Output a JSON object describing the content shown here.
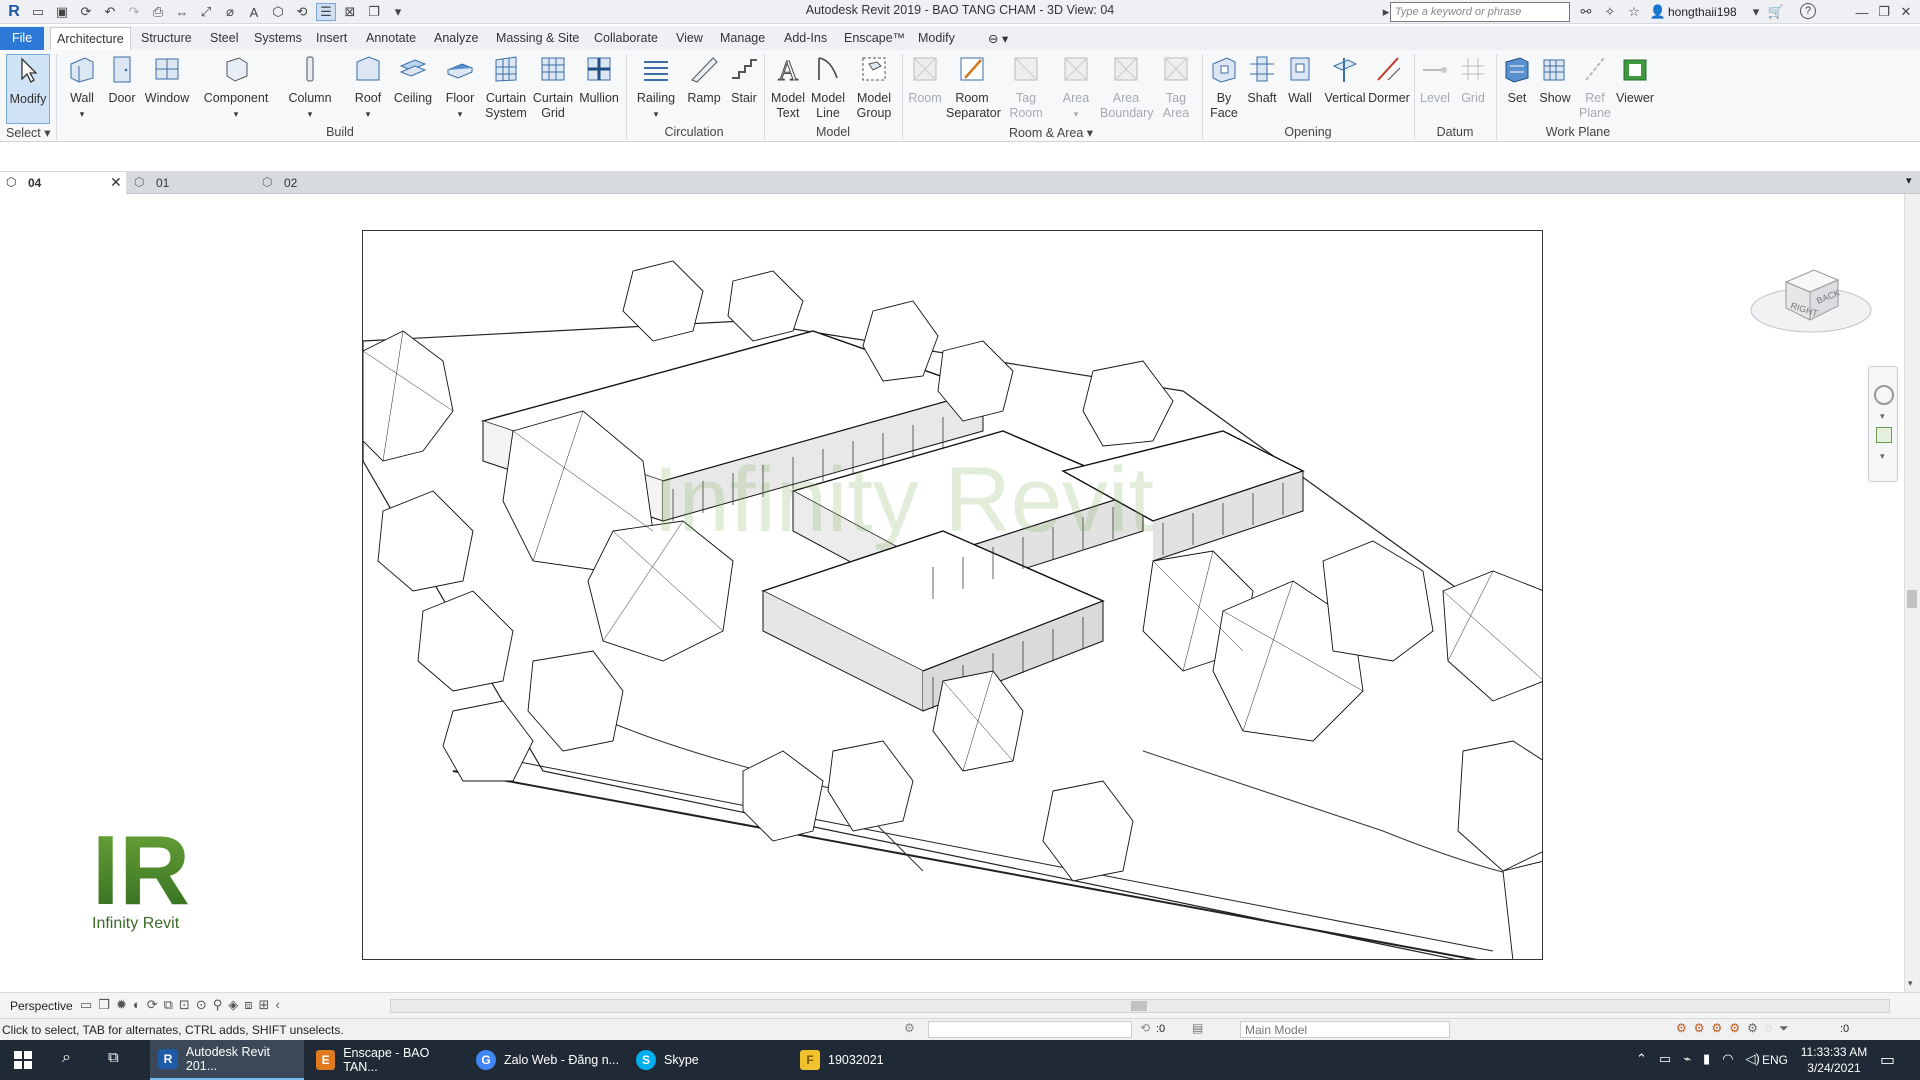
{
  "app": {
    "title": "Autodesk Revit 2019 - BAO TANG CHAM - 3D View: 04",
    "search_placeholder": "Type a keyword or phrase",
    "user": "hongthaii198",
    "help": "?"
  },
  "menu_tabs": [
    "File",
    "Architecture",
    "Structure",
    "Steel",
    "Systems",
    "Insert",
    "Annotate",
    "Analyze",
    "Massing & Site",
    "Collaborate",
    "View",
    "Manage",
    "Add-Ins",
    "Enscape™",
    "Modify"
  ],
  "ribbon": {
    "select": {
      "modify": "Modify",
      "label": "Select"
    },
    "build": {
      "label": "Build",
      "items": [
        "Wall",
        "Door",
        "Window",
        "Component",
        "Column",
        "Roof",
        "Ceiling",
        "Floor",
        "Curtain",
        "Curtain",
        "Mullion"
      ],
      "sub": [
        "",
        "",
        "",
        "",
        "",
        "",
        "",
        "",
        "System",
        "Grid",
        ""
      ]
    },
    "circulation": {
      "label": "Circulation",
      "items": [
        "Railing",
        "Ramp",
        "Stair"
      ]
    },
    "model": {
      "label": "Model",
      "items": [
        "Model",
        "Model",
        "Model"
      ],
      "sub": [
        "Text",
        "Line",
        "Group"
      ]
    },
    "room_area": {
      "label": "Room & Area",
      "items": [
        "Room",
        "Room",
        "Tag",
        "Area",
        "Area",
        "Tag"
      ],
      "sub": [
        "",
        "Separator",
        "Room",
        "",
        "Boundary",
        "Area"
      ]
    },
    "opening": {
      "label": "Opening",
      "items": [
        "By",
        "Shaft",
        "Wall",
        "Vertical",
        "Dormer"
      ],
      "sub": [
        "Face",
        "",
        "",
        "",
        ""
      ]
    },
    "datum": {
      "label": "Datum",
      "items": [
        "Level",
        "Grid"
      ]
    },
    "work_plane": {
      "label": "Work Plane",
      "items": [
        "Set",
        "Show",
        "Ref",
        "Viewer"
      ],
      "sub": [
        "",
        "",
        "Plane",
        ""
      ]
    }
  },
  "view_tabs": [
    {
      "label": "04",
      "active": true
    },
    {
      "label": "01",
      "active": false
    },
    {
      "label": "02",
      "active": false
    }
  ],
  "viewcube": {
    "right": "RIGHT",
    "back": "BACK"
  },
  "watermark": "Infinity Revit",
  "logo": {
    "mark": "IR",
    "caption": "Infinity Revit"
  },
  "view_control": {
    "projection": "Perspective"
  },
  "status": {
    "hint": "Click to select, TAB for alternates, CTRL adds, SHIFT unselects.",
    "count": ":0",
    "model": "Main Model",
    "filter_count": ":0"
  },
  "taskbar": {
    "apps": [
      {
        "label": "Autodesk Revit 201...",
        "icon": "R",
        "color": "#1f5aa6",
        "active": true
      },
      {
        "label": "Enscape - BAO TAN...",
        "icon": "E",
        "color": "#e07a1f",
        "active": false
      },
      {
        "label": "Zalo Web - Đăng n...",
        "icon": "G",
        "color": "#4285f4",
        "active": false
      },
      {
        "label": "Skype",
        "icon": "S",
        "color": "#00aff0",
        "active": false
      },
      {
        "label": "19032021",
        "icon": "F",
        "color": "#f2c12e",
        "active": false
      }
    ],
    "lang": "ENG",
    "time": "11:33:33 AM",
    "date": "3/24/2021"
  }
}
